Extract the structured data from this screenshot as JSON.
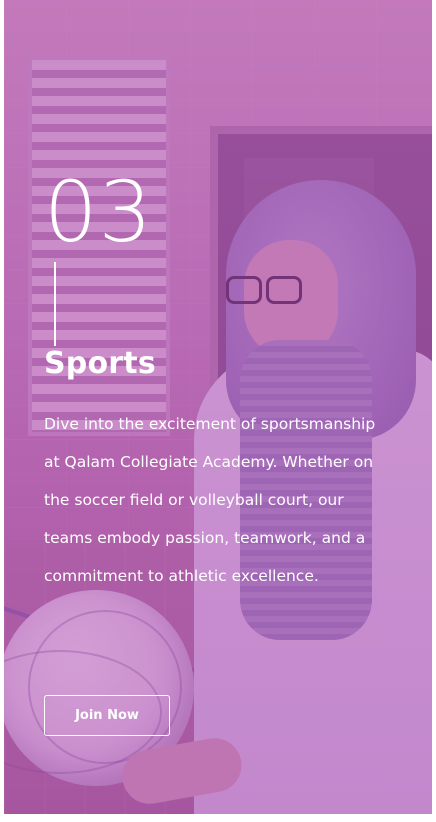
{
  "card": {
    "number": "03",
    "title": "Sports",
    "description": "Dive into the excitement of sportsmanship at Qalam Collegiate Academy. Whether on the soccer field or volleyball court, our teams embody passion, teamwork, and a commitment to athletic excellence.",
    "button_label": "Join Now"
  },
  "colors": {
    "overlay": "#a83aaa",
    "text": "#ffffff"
  }
}
